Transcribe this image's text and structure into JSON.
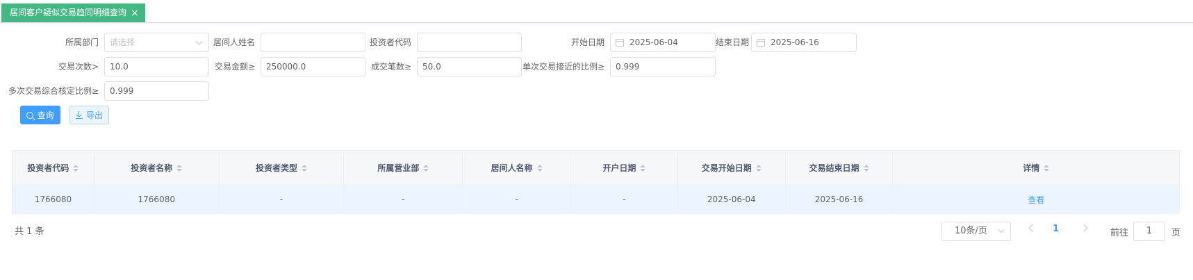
{
  "tab": {
    "title": "居间客户疑似交易趋同明细查询",
    "close_glyph": "×"
  },
  "filters": {
    "department": {
      "label": "所属部门",
      "placeholder": "请选择"
    },
    "broker_name": {
      "label": "居间人姓名",
      "value": ""
    },
    "investor_code": {
      "label": "投资者代码",
      "value": ""
    },
    "start_date": {
      "label": "开始日期",
      "value": "2025-06-04"
    },
    "end_date": {
      "label": "结束日期",
      "value": "2025-06-16"
    },
    "trade_count": {
      "label": "交易次数>",
      "value": "10.0"
    },
    "trade_amount": {
      "label": "交易金额≥",
      "value": "250000.0"
    },
    "deal_count": {
      "label": "成交笔数≥",
      "value": "50.0"
    },
    "single_ratio": {
      "label": "单次交易接近的比例≥",
      "value": "0.999"
    },
    "multi_ratio": {
      "label": "多次交易综合核定比例≥",
      "value": "0.999"
    }
  },
  "actions": {
    "query_label": "查询",
    "export_label": "导出"
  },
  "table": {
    "columns": [
      "投资者代码",
      "投资者名称",
      "投资者类型",
      "所属营业部",
      "居间人名称",
      "开户日期",
      "交易开始日期",
      "交易结束日期",
      "详情"
    ],
    "rows": [
      [
        "1766080",
        "1766080",
        "-",
        "-",
        "-",
        "-",
        "2025-06-04",
        "2025-06-16",
        "查看"
      ]
    ]
  },
  "pagination": {
    "total_label": "共 1 条",
    "page_size": "10条/页",
    "current_page": "1",
    "goto_prefix": "前往",
    "goto_value": "1",
    "goto_suffix": "页"
  },
  "colors": {
    "tab_active": "#42b983",
    "primary": "#409eff",
    "row_highlight": "#ecf5ff"
  }
}
